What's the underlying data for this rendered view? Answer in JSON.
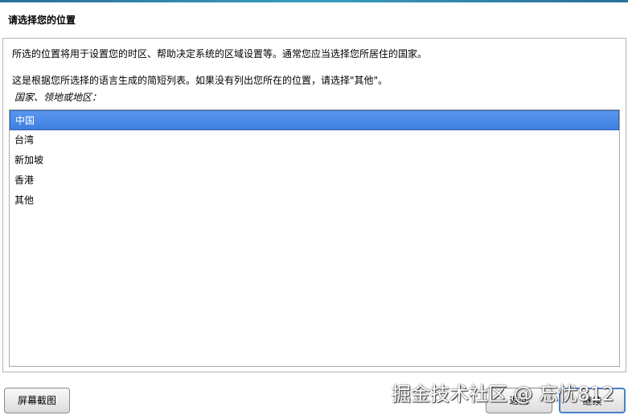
{
  "title": "请选择您的位置",
  "description1": "所选的位置将用于设置您的时区、帮助决定系统的区域设置等。通常您应当选择您所居住的国家。",
  "description2": "这是根据您所选择的语言生成的简短列表。如果没有列出您所在的位置，请选择\"其他\"。",
  "list_label": "国家、领地或地区：",
  "countries": [
    "中国",
    "台湾",
    "新加坡",
    "香港",
    "其他"
  ],
  "selected": "中国",
  "buttons": {
    "screenshot": "屏幕截图",
    "back": "返回",
    "continue": "继续"
  },
  "watermark": "掘金技术社区 @ 忘忧812"
}
